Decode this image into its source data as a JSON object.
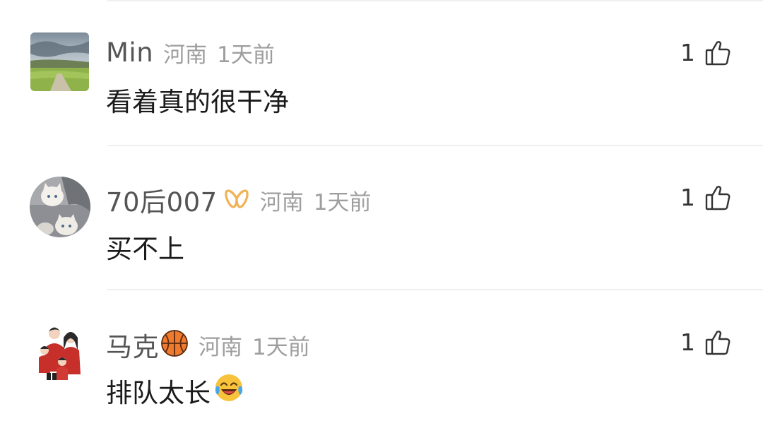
{
  "comments": [
    {
      "username": "Min",
      "location": "河南",
      "time": "1天前",
      "text": "看着真的很干净",
      "likes": "1",
      "avatar_icon": "landscape-avatar",
      "badge_icon": null,
      "emoji_icon": null
    },
    {
      "username": "70后007",
      "location": "河南",
      "time": "1天前",
      "text": "买不上",
      "likes": "1",
      "avatar_icon": "kittens-avatar",
      "badge_icon": "gold-ribbon-badge",
      "emoji_icon": null
    },
    {
      "username": "马克",
      "location": "河南",
      "time": "1天前",
      "text": "排队太长",
      "likes": "1",
      "avatar_icon": "family-cartoon-avatar",
      "badge_icon": "basketball-emoji",
      "emoji_icon": "laughing-crying-emoji"
    }
  ],
  "colors": {
    "username": "#555555",
    "meta": "#9e9e9e",
    "text": "#1a1a1a",
    "divider": "#efefef",
    "badge_gold": "#f0b253",
    "basketball": "#ee7a2e"
  }
}
